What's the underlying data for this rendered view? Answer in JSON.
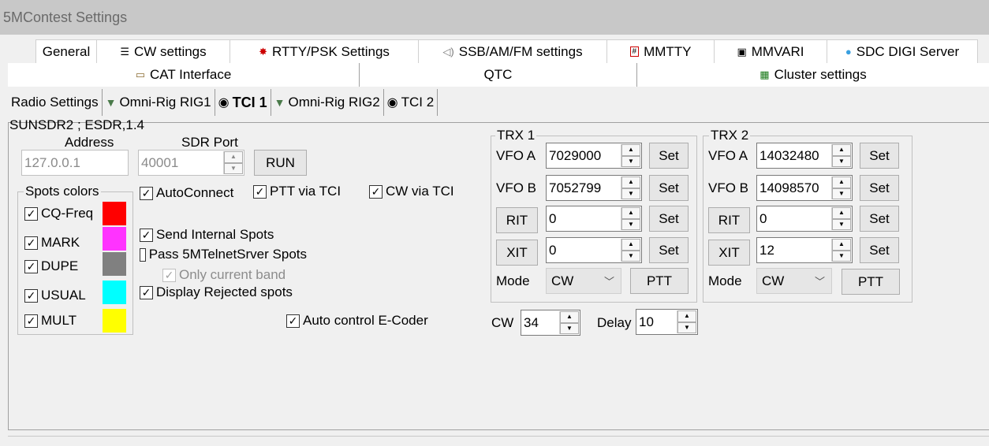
{
  "window": {
    "title": "5MContest Settings"
  },
  "tabs_row1": [
    {
      "label": "General",
      "icon": ""
    },
    {
      "label": "CW settings",
      "icon": "cw-icon"
    },
    {
      "label": "RTTY/PSK Settings",
      "icon": "rtty-icon"
    },
    {
      "label": "SSB/AM/FM settings",
      "icon": "speaker-icon"
    },
    {
      "label": "MMTTY",
      "icon": "mmtty-icon"
    },
    {
      "label": "MMVARI",
      "icon": "mmvari-icon"
    },
    {
      "label": "SDC DIGI Server",
      "icon": "sdc-icon"
    }
  ],
  "tabs_row2": [
    {
      "label": "CAT Interface",
      "icon": "cat-icon"
    },
    {
      "label": "QTC"
    },
    {
      "label": "Cluster settings",
      "icon": "cluster-icon"
    }
  ],
  "subtabs": [
    {
      "label": "Radio Settings"
    },
    {
      "label": "Omni-Rig RIG1",
      "icon": "omnirig-icon"
    },
    {
      "label": "TCI 1",
      "icon": "tci-icon",
      "active": true
    },
    {
      "label": "Omni-Rig RIG2",
      "icon": "omnirig-icon"
    },
    {
      "label": "TCI 2",
      "icon": "tci-icon"
    }
  ],
  "panel": {
    "title": "SUNSDR2 ; ESDR,1.4",
    "address_label": "Address",
    "address_value": "127.0.0.1",
    "port_label": "SDR Port",
    "port_value": "40001",
    "run_label": "RUN"
  },
  "spots_colors": {
    "title": "Spots colors",
    "items": [
      {
        "label": "CQ-Freq",
        "checked": true,
        "color": "#ff0000"
      },
      {
        "label": "MARK",
        "checked": true,
        "color": "#ff33ff"
      },
      {
        "label": "DUPE",
        "checked": true,
        "color": "#808080"
      },
      {
        "label": "USUAL",
        "checked": true,
        "color": "#00ffff"
      },
      {
        "label": "MULT",
        "checked": true,
        "color": "#ffff00"
      }
    ]
  },
  "options": {
    "autoconnect": "AutoConnect",
    "ptt_via_tci": "PTT via TCI",
    "cw_via_tci": "CW via TCI",
    "send_internal_spots": "Send Internal Spots",
    "pass_telnet": "Pass 5MTelnetSrver Spots",
    "only_current_band": "Only current band",
    "display_rejected": "Display Rejected spots",
    "auto_control_ecoder": "Auto control E-Coder"
  },
  "trx1": {
    "title": "TRX 1",
    "vfo_a_label": "VFO A",
    "vfo_a_value": "7029000",
    "vfo_b_label": "VFO B",
    "vfo_b_value": "7052799",
    "rit_label": "RIT",
    "rit_value": "0",
    "xit_label": "XIT",
    "xit_value": "0",
    "set_label": "Set",
    "mode_label": "Mode",
    "mode_value": "CW",
    "ptt_label": "PTT"
  },
  "trx2": {
    "title": "TRX 2",
    "vfo_a_label": "VFO A",
    "vfo_a_value": "14032480",
    "vfo_b_label": "VFO B",
    "vfo_b_value": "14098570",
    "rit_label": "RIT",
    "rit_value": "0",
    "xit_label": "XIT",
    "xit_value": "12",
    "set_label": "Set",
    "mode_label": "Mode",
    "mode_value": "CW",
    "ptt_label": "PTT"
  },
  "cw_speed": {
    "label": "CW",
    "value": "34"
  },
  "delay": {
    "label": "Delay",
    "value": "10"
  }
}
